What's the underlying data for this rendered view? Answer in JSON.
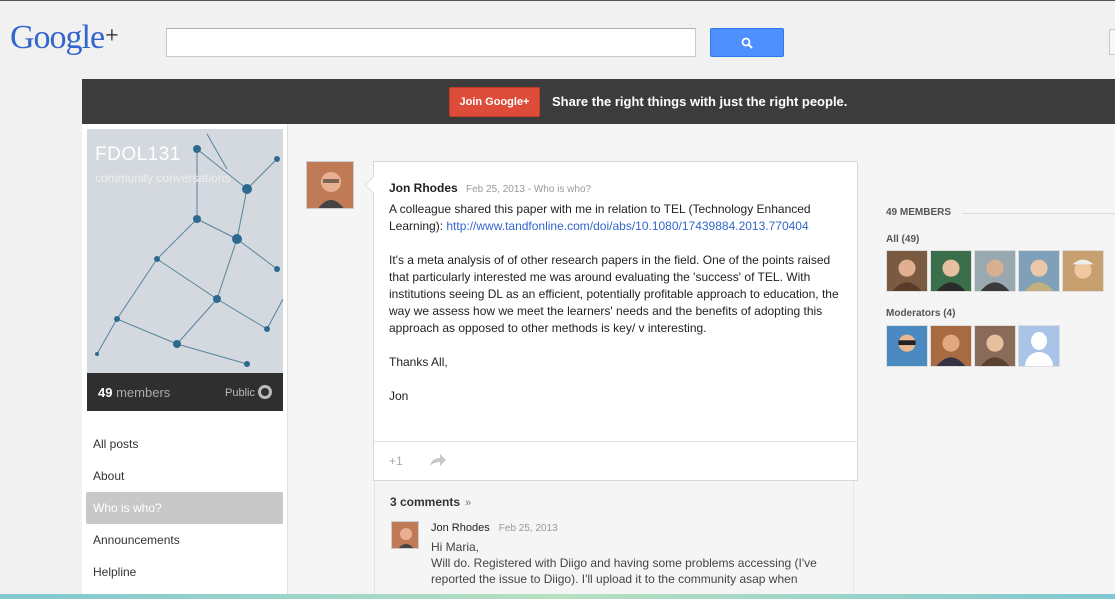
{
  "header": {
    "logo_text": "Google",
    "logo_plus": "+",
    "search_placeholder": ""
  },
  "banner": {
    "join_label": "Join Google+",
    "tagline": "Share the right things with just the right people."
  },
  "community": {
    "title": "FDOL131",
    "subtitle": "community conversations",
    "members_number": "49",
    "members_label": "members",
    "visibility": "Public"
  },
  "nav": {
    "items": [
      {
        "label": "All posts"
      },
      {
        "label": "About"
      },
      {
        "label": "Who is who?"
      },
      {
        "label": "Announcements"
      },
      {
        "label": "Helpline"
      }
    ]
  },
  "post": {
    "author": "Jon Rhodes",
    "meta": "Feb 25, 2013  -  Who is who?",
    "p1_text": "A colleague shared this paper with me in relation to TEL (Technology Enhanced Learning): ",
    "p1_link": "http://www.tandfonline.com/doi/abs/10.1080/17439884.2013.770404",
    "p2": "It's a meta analysis of of other research papers in the field. One of the points raised that particularly interested me was around evaluating the 'success' of TEL. With institutions seeing DL as an efficient, potentially profitable approach to education, the way we assess how we meet the learners' needs and the benefits of adopting this approach as opposed to other methods is key/ v interesting.",
    "p3": "Thanks All,",
    "p4": "Jon",
    "plusone_label": "+1"
  },
  "comments": {
    "count_label": "3 comments",
    "chevron": "»",
    "first": {
      "author": "Jon Rhodes",
      "date": "Feb 25, 2013",
      "body_line1": "Hi Maria,",
      "body_line2": "Will do. Registered with Diigo and having some problems accessing (I've reported the issue to Diigo). I'll upload it to the community asap when"
    }
  },
  "members_panel": {
    "heading": "49 MEMBERS",
    "all_label": "All (49)",
    "moderators_label": "Moderators (4)"
  },
  "colors": {
    "accent_blue": "#4d90fe",
    "join_red": "#dd4b39",
    "banner_dark": "#3c3c3c",
    "link_blue": "#3366cc"
  },
  "icons": [
    "search-icon",
    "globe-icon",
    "share-icon",
    "chevron-down-icon"
  ]
}
